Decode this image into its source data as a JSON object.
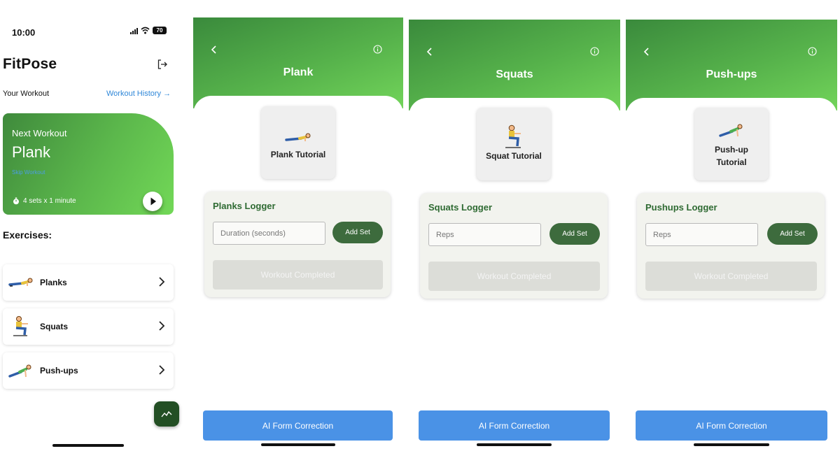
{
  "status": {
    "time": "10:00",
    "battery": "70"
  },
  "home": {
    "app_title": "FitPose",
    "your_workout_label": "Your Workout",
    "workout_history_link": "Workout History →",
    "next_workout": {
      "label": "Next Workout",
      "name": "Plank",
      "skip_label": "Skip Workout",
      "sets_text": "4 sets x 1 minute"
    },
    "exercises_title": "Exercises:",
    "exercises": [
      {
        "label": "Planks",
        "icon": "plank-figure-icon"
      },
      {
        "label": "Squats",
        "icon": "squat-figure-icon"
      },
      {
        "label": "Push-ups",
        "icon": "pushup-figure-icon"
      }
    ]
  },
  "screens": [
    {
      "title": "Plank",
      "tutorial_label": "Plank Tutorial",
      "logger_title": "Planks Logger",
      "input_placeholder": "Duration (seconds)",
      "add_set_label": "Add Set",
      "completed_label": "Workout Completed",
      "ai_button_label": "AI Form Correction"
    },
    {
      "title": "Squats",
      "tutorial_label": "Squat Tutorial",
      "logger_title": "Squats Logger",
      "input_placeholder": "Reps",
      "add_set_label": "Add Set",
      "completed_label": "Workout Completed",
      "ai_button_label": "AI Form Correction"
    },
    {
      "title": "Push-ups",
      "tutorial_label": "Push-up Tutorial",
      "logger_title": "Pushups Logger",
      "input_placeholder": "Reps",
      "add_set_label": "Add Set",
      "completed_label": "Workout Completed",
      "ai_button_label": "AI Form Correction"
    }
  ],
  "colors": {
    "header_green": "#56b24b",
    "dark_green": "#3d6b3d",
    "link_blue": "#2f87d8",
    "ai_button_blue": "#4a92e6",
    "logger_bg": "#f2f3ee"
  }
}
